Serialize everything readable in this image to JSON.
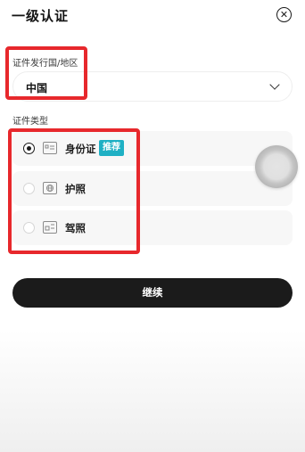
{
  "header": {
    "title": "一级认证",
    "close_icon": "close-circle-icon"
  },
  "country_section": {
    "label": "证件发行国/地区",
    "selected_value": "中国",
    "dropdown_icon": "chevron-down-icon"
  },
  "doc_type_section": {
    "label": "证件类型",
    "options": [
      {
        "label": "身份证",
        "badge": "推荐",
        "selected": true,
        "icon": "id-card-icon"
      },
      {
        "label": "护照",
        "selected": false,
        "icon": "passport-icon"
      },
      {
        "label": "驾照",
        "selected": false,
        "icon": "driver-license-icon"
      }
    ]
  },
  "continue_button": {
    "label": "继续"
  },
  "colors": {
    "highlight": "#e7282c",
    "badge": "#1fb0c4",
    "button": "#1b1b1b"
  }
}
